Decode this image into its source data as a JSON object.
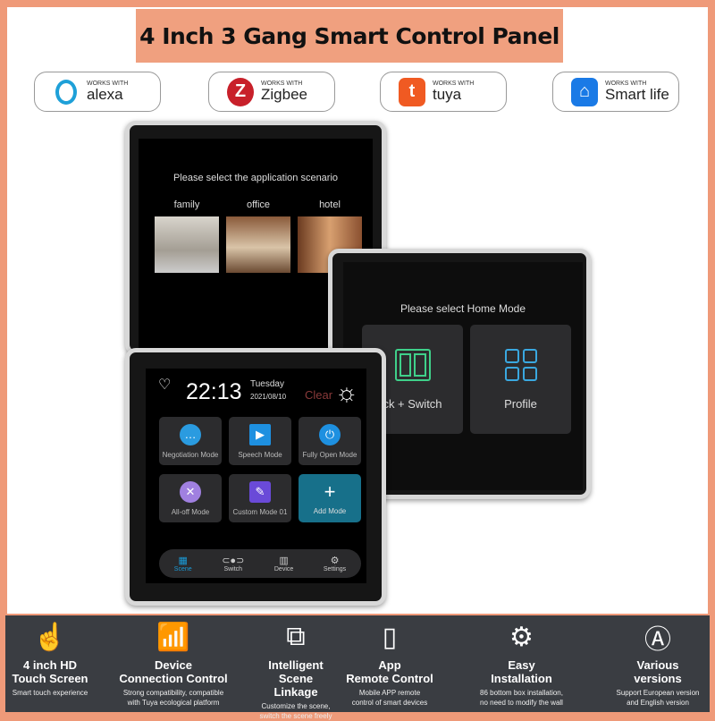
{
  "title": "4 Inch 3 Gang Smart Control Panel",
  "badges": [
    {
      "works": "WORKS WITH",
      "name": "alexa",
      "icon": "alexa-ring-icon",
      "color": "#1ea0d8"
    },
    {
      "works": "WORKS WITH",
      "name": "Zigbee",
      "icon": "zigbee-icon",
      "color": "#c8202a"
    },
    {
      "works": "WORKS WITH",
      "name": "tuya",
      "icon": "tuya-icon",
      "color": "#f05a22"
    },
    {
      "works": "WORKS WITH",
      "name": "Smart life",
      "icon": "smart-life-house-icon",
      "color": "#1a7ae6"
    }
  ],
  "back_panel": {
    "prompt": "Please select the application scenario",
    "scenarios": [
      "family",
      "office",
      "hotel"
    ]
  },
  "right_panel": {
    "prompt": "Please select Home Mode",
    "options": [
      "ck + Switch",
      "Profile"
    ]
  },
  "front_panel": {
    "time": "22:13",
    "day": "Tuesday",
    "date": "2021/08/10",
    "weather": "Clear",
    "modes": [
      "Negotiation Mode",
      "Speech Mode",
      "Fully Open Mode",
      "All-off Mode",
      "Custom Mode 01",
      "Add Mode"
    ],
    "nav": [
      "Scene",
      "Switch",
      "Device",
      "Settings"
    ],
    "active_nav": "Scene",
    "accent": "#1a9ad6"
  },
  "features": [
    {
      "title": "4 inch HD",
      "title2": "Touch Screen",
      "sub": "Smart touch experience",
      "sub2": "",
      "icon": "touch-hand-icon"
    },
    {
      "title": "Device",
      "title2": "Connection Control",
      "sub": "Strong compatibility, compatible",
      "sub2": "with Tuya ecological platform",
      "icon": "wifi-phone-icon"
    },
    {
      "title": "Intelligent",
      "title2": "Scene Linkage",
      "sub": "Customize the scene,",
      "sub2": "switch the scene freely",
      "icon": "overlapping-panels-icon"
    },
    {
      "title": "App",
      "title2": "Remote Control",
      "sub": "Mobile APP remote",
      "sub2": "control of smart devices",
      "icon": "phone-icon"
    },
    {
      "title": "Easy",
      "title2": "Installation",
      "sub": "86 bottom box installation,",
      "sub2": "no need to modify the wall",
      "icon": "gear-screwdriver-icon"
    },
    {
      "title": "Various",
      "title2": "versions",
      "sub": "Support European version",
      "sub2": "and English version",
      "icon": "letter-a-circle-icon"
    }
  ]
}
